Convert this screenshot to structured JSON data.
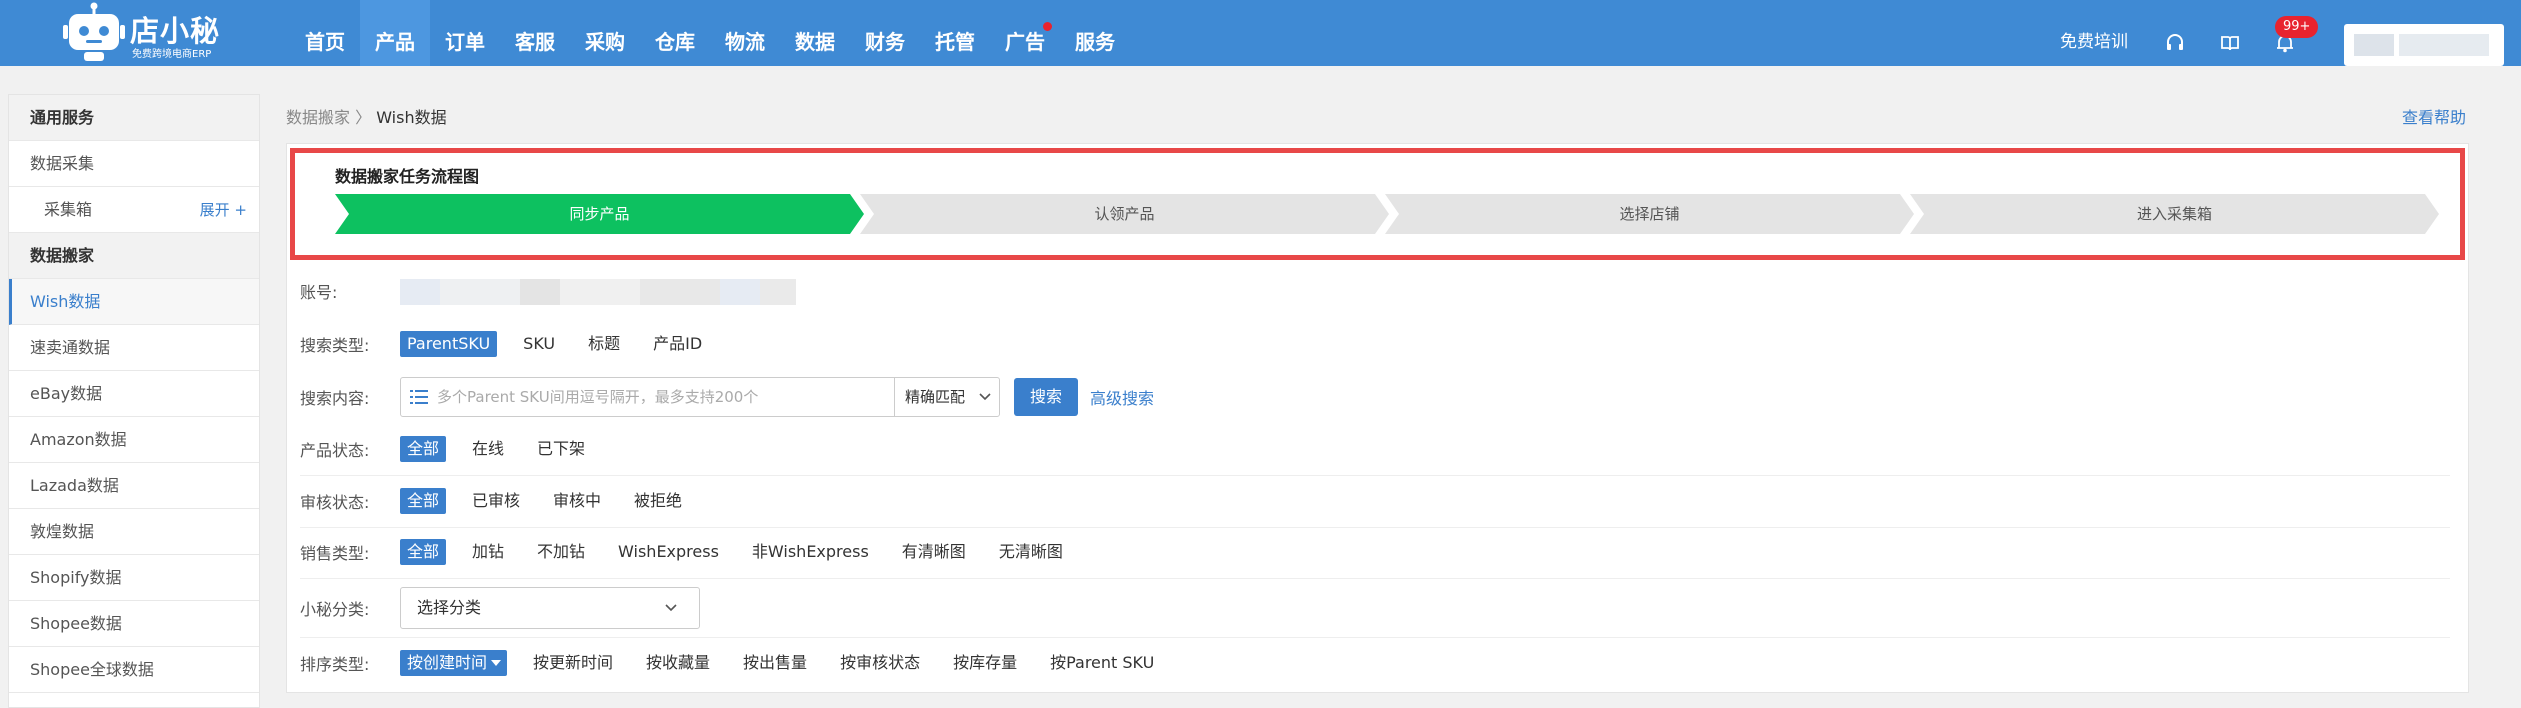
{
  "brand": {
    "name": "店小秘",
    "subtitle": "免费跨境电商ERP"
  },
  "nav": {
    "items": [
      {
        "label": "首页"
      },
      {
        "label": "产品",
        "active": true
      },
      {
        "label": "订单"
      },
      {
        "label": "客服"
      },
      {
        "label": "采购"
      },
      {
        "label": "仓库"
      },
      {
        "label": "物流"
      },
      {
        "label": "数据"
      },
      {
        "label": "财务"
      },
      {
        "label": "托管"
      },
      {
        "label": "广告",
        "dot": true
      },
      {
        "label": "服务"
      }
    ],
    "training": "免费培训",
    "notification_count": "99+"
  },
  "sidebar": {
    "items": [
      {
        "label": "通用服务",
        "type": "header"
      },
      {
        "label": "数据采集"
      },
      {
        "label": "采集箱",
        "type": "sub",
        "extra": "展开 +"
      },
      {
        "label": "数据搬家",
        "type": "header"
      },
      {
        "label": "Wish数据",
        "active": true
      },
      {
        "label": "速卖通数据"
      },
      {
        "label": "eBay数据"
      },
      {
        "label": "Amazon数据"
      },
      {
        "label": "Lazada数据"
      },
      {
        "label": "敦煌数据"
      },
      {
        "label": "Shopify数据"
      },
      {
        "label": "Shopee数据"
      },
      {
        "label": "Shopee全球数据"
      }
    ]
  },
  "breadcrumb": {
    "parent": "数据搬家",
    "separator": " 〉",
    "current": "Wish数据"
  },
  "help": "查看帮助",
  "flow": {
    "title": "数据搬家任务流程图",
    "steps": [
      "同步产品",
      "认领产品",
      "选择店铺",
      "进入采集箱"
    ]
  },
  "filters": {
    "account": {
      "label": "账号:"
    },
    "search_type": {
      "label": "搜索类型:",
      "options": [
        "ParentSKU",
        "SKU",
        "标题",
        "产品ID"
      ]
    },
    "search_content": {
      "label": "搜索内容:",
      "placeholder": "多个Parent SKU间用逗号隔开，最多支持200个",
      "match": "精确匹配",
      "search_button": "搜索",
      "advanced": "高级搜索"
    },
    "product_status": {
      "label": "产品状态:",
      "options": [
        "全部",
        "在线",
        "已下架"
      ]
    },
    "review_status": {
      "label": "审核状态:",
      "options": [
        "全部",
        "已审核",
        "审核中",
        "被拒绝"
      ]
    },
    "sale_type": {
      "label": "销售类型:",
      "options": [
        "全部",
        "加钻",
        "不加钻",
        "WishExpress",
        "非WishExpress",
        "有清晰图",
        "无清晰图"
      ]
    },
    "category": {
      "label": "小秘分类:",
      "value": "选择分类"
    },
    "sort": {
      "label": "排序类型:",
      "options": [
        "按创建时间",
        "按更新时间",
        "按收藏量",
        "按出售量",
        "按审核状态",
        "按库存量",
        "按Parent SKU"
      ]
    }
  },
  "colors": {
    "topbar": "#3f8ad4",
    "accent": "#3a7fcc",
    "step_active": "#0dc160",
    "step_inactive": "#e4e4e4",
    "highlight_border": "#e84848",
    "badge": "#e8232e"
  }
}
